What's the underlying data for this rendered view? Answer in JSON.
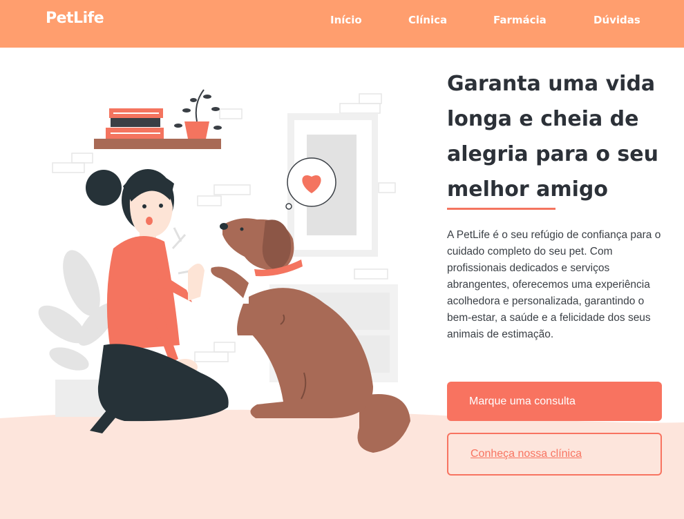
{
  "brand": {
    "name": "PetLife"
  },
  "nav": {
    "items": [
      {
        "label": "Início"
      },
      {
        "label": "Clínica"
      },
      {
        "label": "Farmácia"
      },
      {
        "label": "Dúvidas"
      }
    ]
  },
  "hero": {
    "headline": "Garanta uma vida longa e cheia de alegria para o seu melhor amigo",
    "description": "A PetLife é o seu refúgio de confiança para o cuidado completo do seu pet. Com profissionais dedicados e serviços abrangentes, oferecemos uma experiência acolhedora e personalizada, garantindo o bem-estar, a saúde e a felicidade dos seus animais de estimação.",
    "primary_cta": "Marque uma consulta",
    "secondary_cta": "Conheça nossa clínica"
  },
  "colors": {
    "header": "#ff9e6e",
    "accent": "#f87360",
    "floor": "#fde5dc",
    "text": "#2c3138"
  },
  "illustration": {
    "subject": "woman-high-five-dog",
    "icons": [
      "heart-icon",
      "plant-icon",
      "books-icon"
    ]
  }
}
